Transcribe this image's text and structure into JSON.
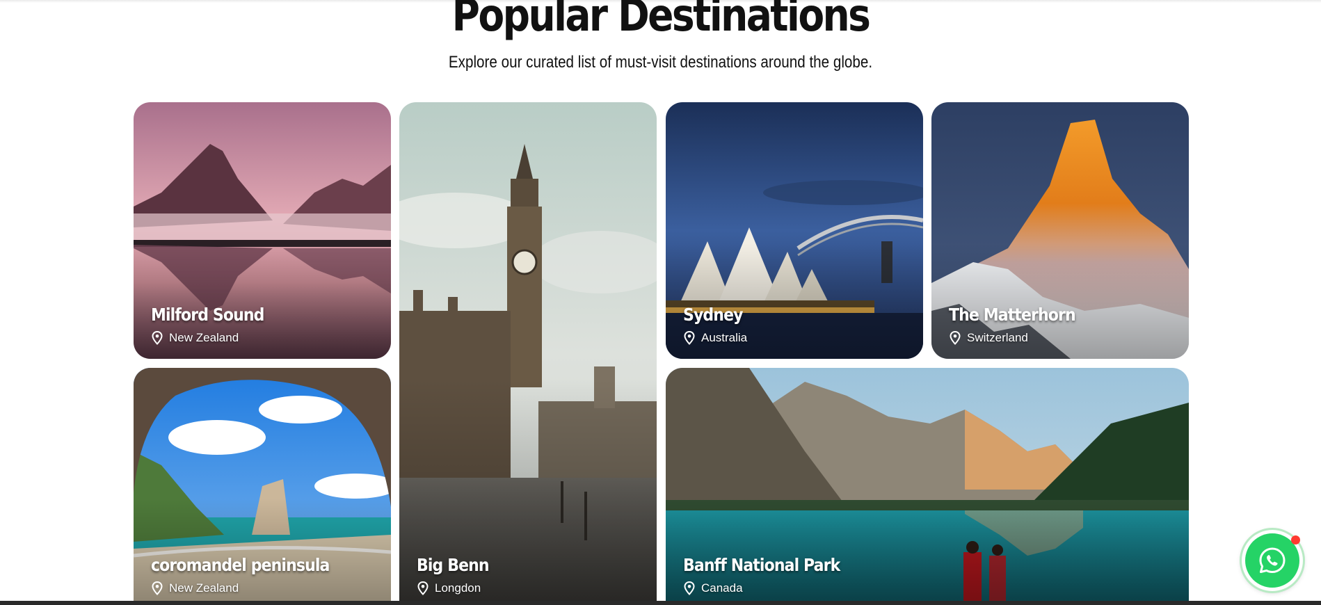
{
  "section": {
    "title": "Popular Destinations",
    "subtitle": "Explore our curated list of must-visit destinations around the globe."
  },
  "destinations": [
    {
      "name": "Milford Sound",
      "location": "New Zealand"
    },
    {
      "name": "Big Benn",
      "location": "Longdon"
    },
    {
      "name": "Sydney",
      "location": "Australia"
    },
    {
      "name": "The Matterhorn",
      "location": "Switzerland"
    },
    {
      "name": "coromandel peninsula",
      "location": "New Zealand"
    },
    {
      "name": "Banff National Park",
      "location": "Canada"
    }
  ],
  "icons": {
    "location": "map-pin-icon",
    "chat": "whatsapp-icon",
    "notification": "notification-dot"
  },
  "colors": {
    "whatsapp_green": "#25d366",
    "notification_red": "#ff3b30",
    "text_dark": "#111111"
  }
}
